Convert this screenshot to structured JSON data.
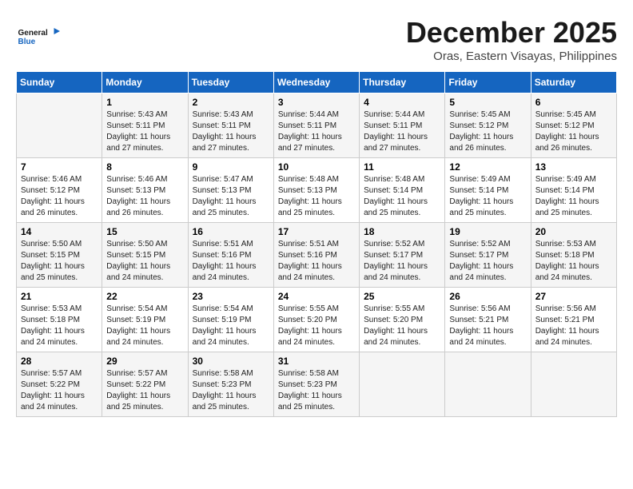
{
  "header": {
    "logo_line1": "General",
    "logo_line2": "Blue",
    "month": "December 2025",
    "location": "Oras, Eastern Visayas, Philippines"
  },
  "days_of_week": [
    "Sunday",
    "Monday",
    "Tuesday",
    "Wednesday",
    "Thursday",
    "Friday",
    "Saturday"
  ],
  "weeks": [
    [
      {
        "day": "",
        "sunrise": "",
        "sunset": "",
        "daylight": ""
      },
      {
        "day": "1",
        "sunrise": "Sunrise: 5:43 AM",
        "sunset": "Sunset: 5:11 PM",
        "daylight": "Daylight: 11 hours and 27 minutes."
      },
      {
        "day": "2",
        "sunrise": "Sunrise: 5:43 AM",
        "sunset": "Sunset: 5:11 PM",
        "daylight": "Daylight: 11 hours and 27 minutes."
      },
      {
        "day": "3",
        "sunrise": "Sunrise: 5:44 AM",
        "sunset": "Sunset: 5:11 PM",
        "daylight": "Daylight: 11 hours and 27 minutes."
      },
      {
        "day": "4",
        "sunrise": "Sunrise: 5:44 AM",
        "sunset": "Sunset: 5:11 PM",
        "daylight": "Daylight: 11 hours and 27 minutes."
      },
      {
        "day": "5",
        "sunrise": "Sunrise: 5:45 AM",
        "sunset": "Sunset: 5:12 PM",
        "daylight": "Daylight: 11 hours and 26 minutes."
      },
      {
        "day": "6",
        "sunrise": "Sunrise: 5:45 AM",
        "sunset": "Sunset: 5:12 PM",
        "daylight": "Daylight: 11 hours and 26 minutes."
      }
    ],
    [
      {
        "day": "7",
        "sunrise": "Sunrise: 5:46 AM",
        "sunset": "Sunset: 5:12 PM",
        "daylight": "Daylight: 11 hours and 26 minutes."
      },
      {
        "day": "8",
        "sunrise": "Sunrise: 5:46 AM",
        "sunset": "Sunset: 5:13 PM",
        "daylight": "Daylight: 11 hours and 26 minutes."
      },
      {
        "day": "9",
        "sunrise": "Sunrise: 5:47 AM",
        "sunset": "Sunset: 5:13 PM",
        "daylight": "Daylight: 11 hours and 25 minutes."
      },
      {
        "day": "10",
        "sunrise": "Sunrise: 5:48 AM",
        "sunset": "Sunset: 5:13 PM",
        "daylight": "Daylight: 11 hours and 25 minutes."
      },
      {
        "day": "11",
        "sunrise": "Sunrise: 5:48 AM",
        "sunset": "Sunset: 5:14 PM",
        "daylight": "Daylight: 11 hours and 25 minutes."
      },
      {
        "day": "12",
        "sunrise": "Sunrise: 5:49 AM",
        "sunset": "Sunset: 5:14 PM",
        "daylight": "Daylight: 11 hours and 25 minutes."
      },
      {
        "day": "13",
        "sunrise": "Sunrise: 5:49 AM",
        "sunset": "Sunset: 5:14 PM",
        "daylight": "Daylight: 11 hours and 25 minutes."
      }
    ],
    [
      {
        "day": "14",
        "sunrise": "Sunrise: 5:50 AM",
        "sunset": "Sunset: 5:15 PM",
        "daylight": "Daylight: 11 hours and 25 minutes."
      },
      {
        "day": "15",
        "sunrise": "Sunrise: 5:50 AM",
        "sunset": "Sunset: 5:15 PM",
        "daylight": "Daylight: 11 hours and 24 minutes."
      },
      {
        "day": "16",
        "sunrise": "Sunrise: 5:51 AM",
        "sunset": "Sunset: 5:16 PM",
        "daylight": "Daylight: 11 hours and 24 minutes."
      },
      {
        "day": "17",
        "sunrise": "Sunrise: 5:51 AM",
        "sunset": "Sunset: 5:16 PM",
        "daylight": "Daylight: 11 hours and 24 minutes."
      },
      {
        "day": "18",
        "sunrise": "Sunrise: 5:52 AM",
        "sunset": "Sunset: 5:17 PM",
        "daylight": "Daylight: 11 hours and 24 minutes."
      },
      {
        "day": "19",
        "sunrise": "Sunrise: 5:52 AM",
        "sunset": "Sunset: 5:17 PM",
        "daylight": "Daylight: 11 hours and 24 minutes."
      },
      {
        "day": "20",
        "sunrise": "Sunrise: 5:53 AM",
        "sunset": "Sunset: 5:18 PM",
        "daylight": "Daylight: 11 hours and 24 minutes."
      }
    ],
    [
      {
        "day": "21",
        "sunrise": "Sunrise: 5:53 AM",
        "sunset": "Sunset: 5:18 PM",
        "daylight": "Daylight: 11 hours and 24 minutes."
      },
      {
        "day": "22",
        "sunrise": "Sunrise: 5:54 AM",
        "sunset": "Sunset: 5:19 PM",
        "daylight": "Daylight: 11 hours and 24 minutes."
      },
      {
        "day": "23",
        "sunrise": "Sunrise: 5:54 AM",
        "sunset": "Sunset: 5:19 PM",
        "daylight": "Daylight: 11 hours and 24 minutes."
      },
      {
        "day": "24",
        "sunrise": "Sunrise: 5:55 AM",
        "sunset": "Sunset: 5:20 PM",
        "daylight": "Daylight: 11 hours and 24 minutes."
      },
      {
        "day": "25",
        "sunrise": "Sunrise: 5:55 AM",
        "sunset": "Sunset: 5:20 PM",
        "daylight": "Daylight: 11 hours and 24 minutes."
      },
      {
        "day": "26",
        "sunrise": "Sunrise: 5:56 AM",
        "sunset": "Sunset: 5:21 PM",
        "daylight": "Daylight: 11 hours and 24 minutes."
      },
      {
        "day": "27",
        "sunrise": "Sunrise: 5:56 AM",
        "sunset": "Sunset: 5:21 PM",
        "daylight": "Daylight: 11 hours and 24 minutes."
      }
    ],
    [
      {
        "day": "28",
        "sunrise": "Sunrise: 5:57 AM",
        "sunset": "Sunset: 5:22 PM",
        "daylight": "Daylight: 11 hours and 24 minutes."
      },
      {
        "day": "29",
        "sunrise": "Sunrise: 5:57 AM",
        "sunset": "Sunset: 5:22 PM",
        "daylight": "Daylight: 11 hours and 25 minutes."
      },
      {
        "day": "30",
        "sunrise": "Sunrise: 5:58 AM",
        "sunset": "Sunset: 5:23 PM",
        "daylight": "Daylight: 11 hours and 25 minutes."
      },
      {
        "day": "31",
        "sunrise": "Sunrise: 5:58 AM",
        "sunset": "Sunset: 5:23 PM",
        "daylight": "Daylight: 11 hours and 25 minutes."
      },
      {
        "day": "",
        "sunrise": "",
        "sunset": "",
        "daylight": ""
      },
      {
        "day": "",
        "sunrise": "",
        "sunset": "",
        "daylight": ""
      },
      {
        "day": "",
        "sunrise": "",
        "sunset": "",
        "daylight": ""
      }
    ]
  ]
}
